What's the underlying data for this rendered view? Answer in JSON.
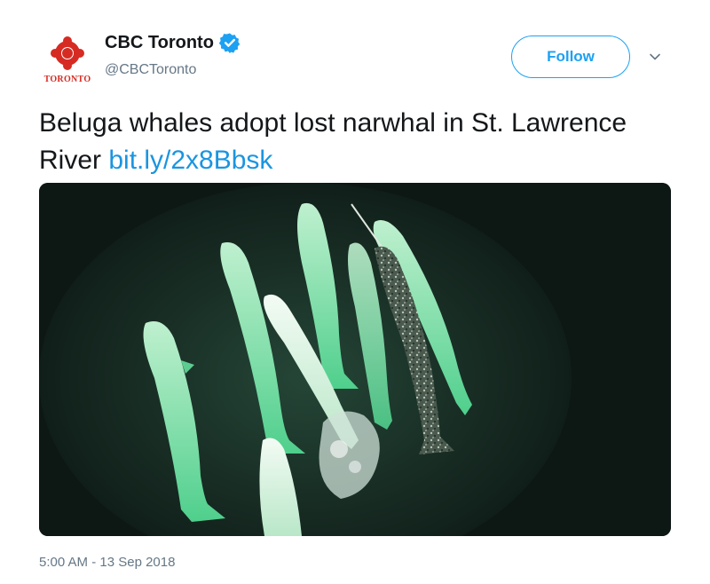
{
  "account": {
    "display_name": "CBC Toronto",
    "handle": "@CBCToronto",
    "logo_label": "TORONTO",
    "verified": true,
    "verified_icon": "verified-badge-icon"
  },
  "actions": {
    "follow_label": "Follow",
    "menu_icon": "chevron-down-icon"
  },
  "tweet": {
    "text": "Beluga whales adopt lost narwhal in St. Lawrence River ",
    "link": "bit.ly/2x8Bbsk",
    "media_description": "Aerial photo of a pod of white beluga whales swimming with a speckled narwhal in dark green water",
    "timestamp": "5:00 AM - 13 Sep 2018"
  },
  "colors": {
    "brand_red": "#d62b23",
    "accent_blue": "#1da1f2",
    "link_blue": "#1b95e0",
    "secondary_text": "#657786",
    "water": "#0e1916",
    "beluga_glow": "#5fd39a"
  }
}
